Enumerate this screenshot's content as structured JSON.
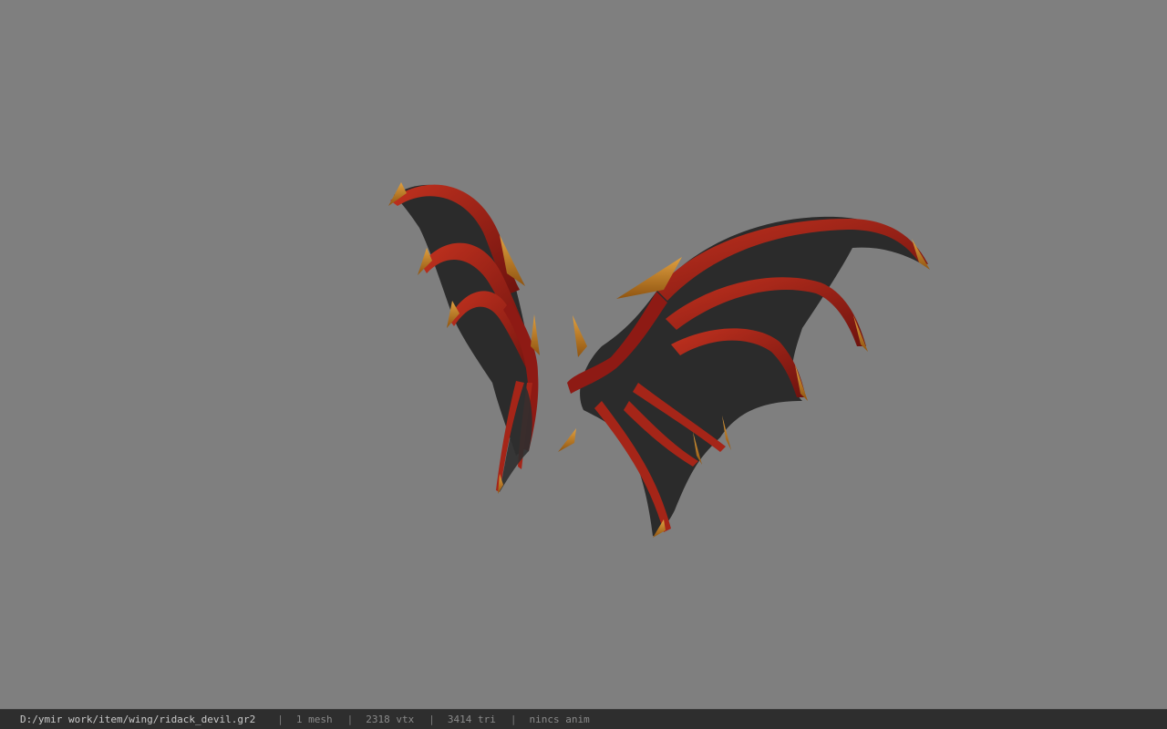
{
  "viewport": {
    "background": "#7f7f7f",
    "model": {
      "description_icon": "dragon-wings-model",
      "colors": {
        "membrane": "#2a2a2a",
        "membrane_edge": "#3a3a3a",
        "bone": "#8e1a14",
        "bone_highlight": "#c2321f",
        "claw": "#d08a2a",
        "claw_dark": "#8f5410"
      }
    }
  },
  "status_bar": {
    "file_path": "D:/ymir work/item/wing/ridack_devil.gr2",
    "separator": "|",
    "mesh_count": "1 mesh",
    "vertex_count": "2318 vtx",
    "triangle_count": "3414 tri",
    "anim_status": "nincs anim"
  }
}
